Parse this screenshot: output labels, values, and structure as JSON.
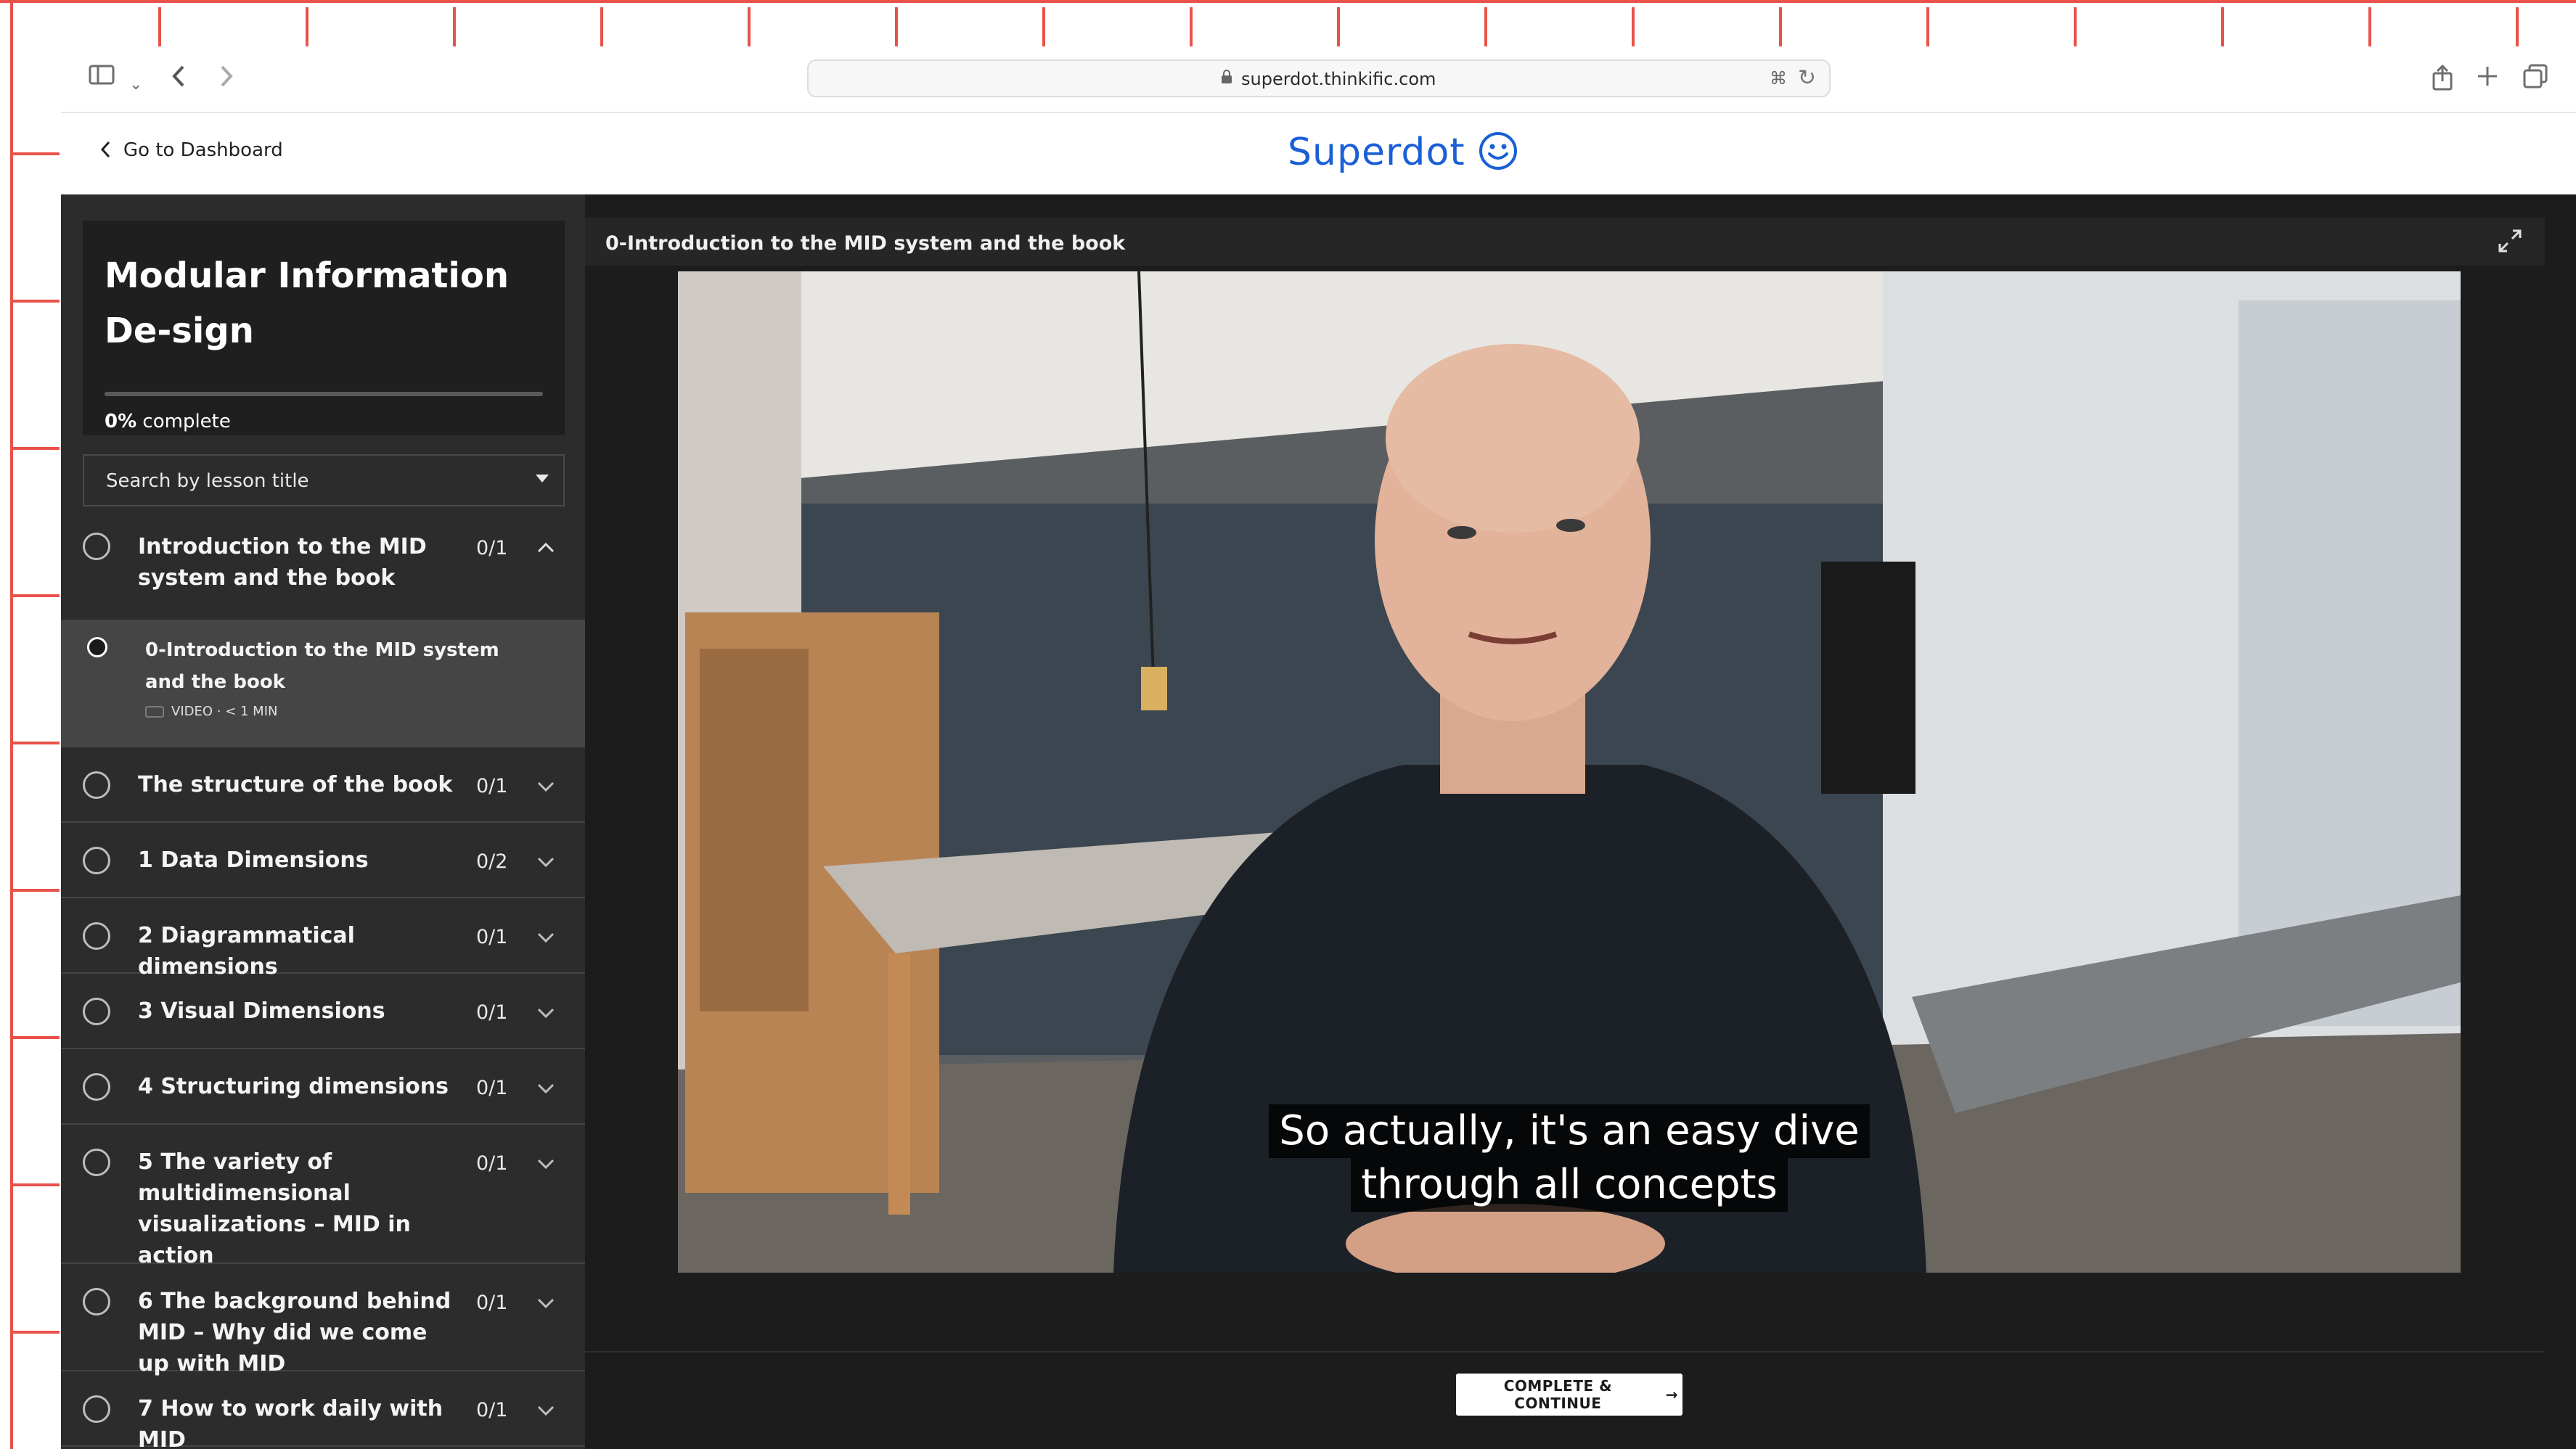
{
  "browser": {
    "url": "superdot.thinkific.com",
    "sidebar_toggle_icon": "sidebar-icon",
    "nav_back_icon": "chevron-left-icon",
    "nav_forward_icon": "chevron-right-icon",
    "share_icon": "share-icon",
    "new_tab_icon": "plus-icon",
    "tabs_icon": "tabs-icon"
  },
  "header": {
    "back_label": "Go to Dashboard",
    "logo_text": "Superdot",
    "brand_color": "#1a5fd6"
  },
  "course": {
    "title": "Modular Information De-sign",
    "progress_value": "0%",
    "progress_suffix": "complete",
    "progress_fraction": 0
  },
  "search": {
    "placeholder": "Search by lesson title"
  },
  "chapters": [
    {
      "title": "Introduction to the MID system and the book",
      "count": "0/1",
      "expanded": true
    },
    {
      "title": "The structure of the book",
      "count": "0/1",
      "expanded": false
    },
    {
      "title": "1 Data Dimensions",
      "count": "0/2",
      "expanded": false
    },
    {
      "title": "2 Diagrammatical dimensions",
      "count": "0/1",
      "expanded": false
    },
    {
      "title": "3 Visual Dimensions",
      "count": "0/1",
      "expanded": false
    },
    {
      "title": "4 Structuring dimensions",
      "count": "0/1",
      "expanded": false
    },
    {
      "title": "5 The variety of multidimensional visualizations – MID in action",
      "count": "0/1",
      "expanded": false
    },
    {
      "title": "6 The background behind MID – Why did we come up with MID",
      "count": "0/1",
      "expanded": false
    },
    {
      "title": "7 How to work daily with MID",
      "count": "0/1",
      "expanded": false
    }
  ],
  "active_lesson": {
    "title": "0-Introduction to the MID system and the book",
    "meta": "VIDEO · < 1 MIN"
  },
  "player": {
    "title": "0-Introduction to the MID system and the book",
    "caption_line1": "So actually, it's an easy dive",
    "caption_line2": "through all concepts",
    "expand_icon": "expand-icon"
  },
  "footer": {
    "complete_label": "COMPLETE & CONTINUE",
    "complete_arrow": "→"
  }
}
